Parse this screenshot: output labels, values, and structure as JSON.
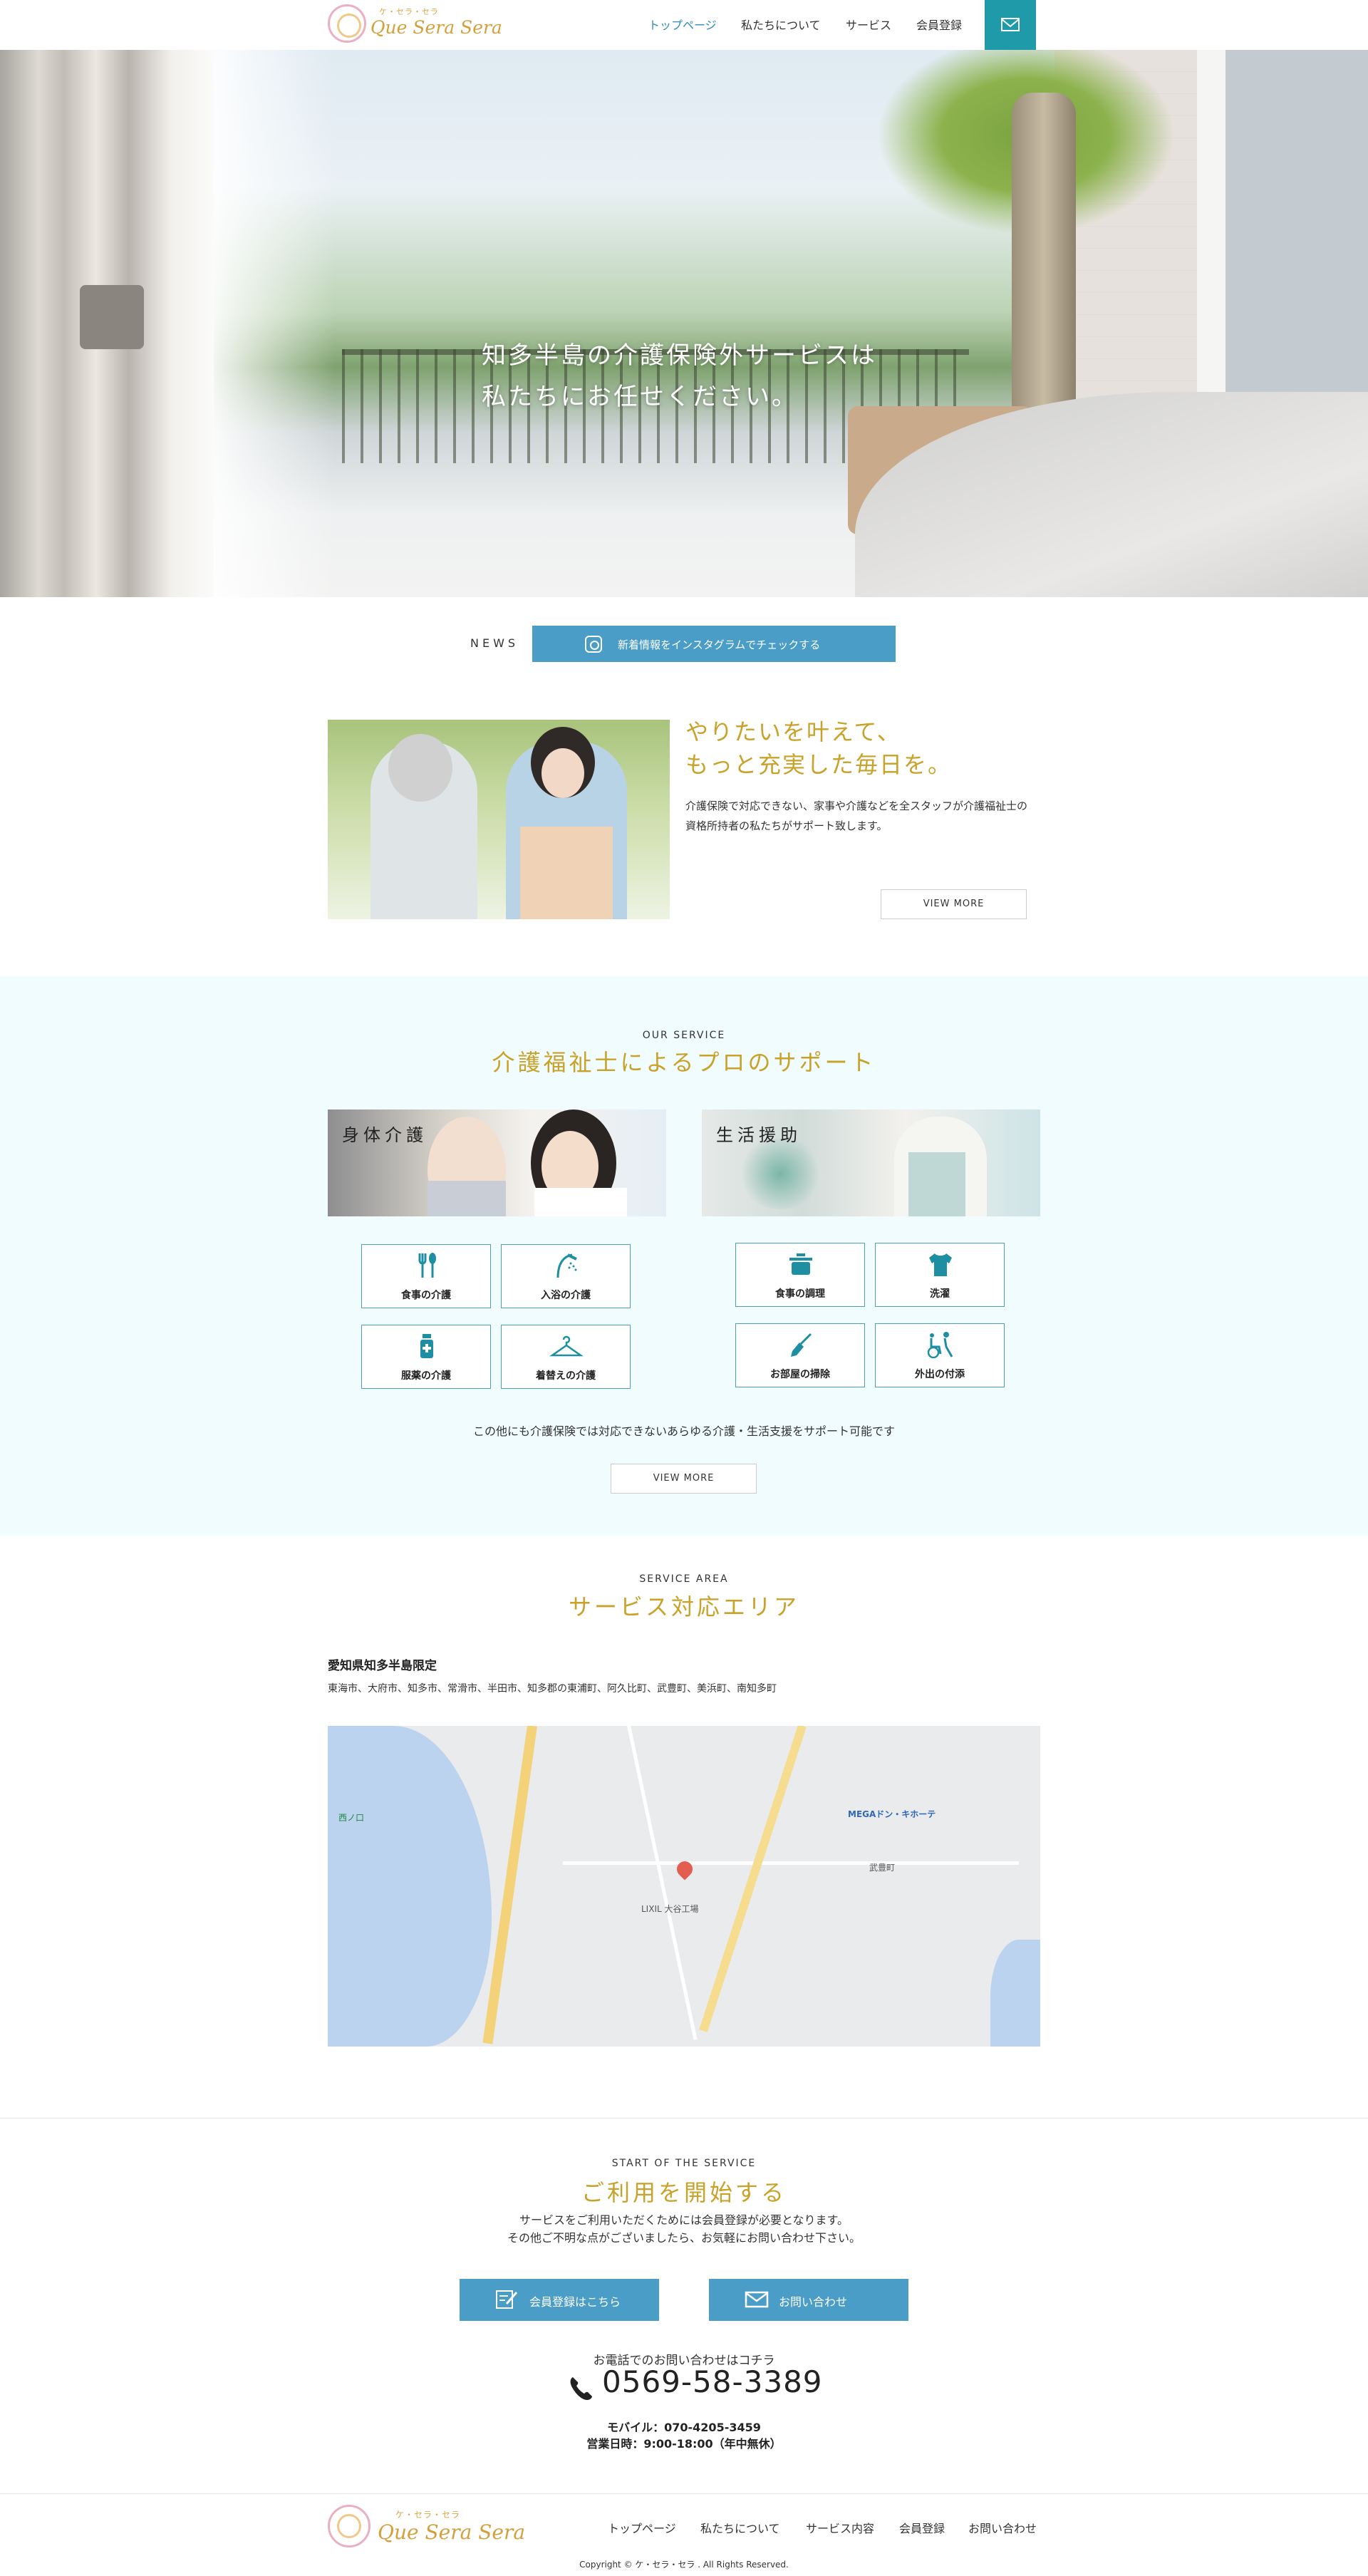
{
  "header": {
    "logo_kana": "ケ・セラ・セラ",
    "logo_text": "Que Sera Sera",
    "nav": {
      "top": "トップページ",
      "about": "私たちについて",
      "service": "サービス",
      "member": "会員登録"
    },
    "mail_icon": "mail-icon",
    "accent_color": "#1e9aa8",
    "active_nav_color": "#2f8cc0"
  },
  "hero": {
    "title_line1": "知多半島の介護保険外サービスは",
    "title_line2": "私たちにお任せください。"
  },
  "news": {
    "label": "NEWS",
    "button_label": "新着情報をインスタグラムでチェックする",
    "button_icon": "instagram-icon",
    "button_color": "#4a9dc6"
  },
  "intro": {
    "title_line1": "やりたいを叶えて、",
    "title_line2": "もっと充実した毎日を。",
    "text": "介護保険で対応できない、家事や介護などを全スタッフが介護福祉士の資格所持者の私たちがサポート致します。",
    "view_more": "VIEW MORE",
    "title_color": "#c9a22a"
  },
  "service": {
    "en": "OUR SERVICE",
    "jp": "介護福祉士によるプロのサポート",
    "physical": {
      "label": "身体介護",
      "items": [
        {
          "label": "食事の介護",
          "icon": "fork-spoon-icon"
        },
        {
          "label": "入浴の介護",
          "icon": "shower-icon"
        },
        {
          "label": "服薬の介護",
          "icon": "medicine-bottle-icon"
        },
        {
          "label": "着替えの介護",
          "icon": "hanger-icon"
        }
      ]
    },
    "life": {
      "label": "生活援助",
      "items": [
        {
          "label": "食事の調理",
          "icon": "pot-icon"
        },
        {
          "label": "洗濯",
          "icon": "shirt-icon"
        },
        {
          "label": "お部屋の掃除",
          "icon": "broom-icon"
        },
        {
          "label": "外出の付添",
          "icon": "wheelchair-icon"
        }
      ]
    },
    "note": "この他にも介護保険では対応できないあらゆる介護・生活支援をサポート可能です",
    "view_more": "VIEW MORE",
    "background_color": "#f0fcfd",
    "icon_color": "#1e8fa3"
  },
  "area": {
    "en": "SERVICE AREA",
    "jp": "サービス対応エリア",
    "prefecture": "愛知県知多半島限定",
    "cities": "東海市、大府市、知多市、常滑市、半田市、知多郡の東浦町、阿久比町、武豊町、美浜町、南知多町",
    "map": {
      "label_mega": "MEGAドン・キホーテ",
      "label_taketoyo": "武豊町",
      "label_lixil": "LIXIL 大谷工場",
      "label_nishinokuchi": "西ノ口"
    }
  },
  "start": {
    "en": "START OF THE SERVICE",
    "jp": "ご利用を開始する",
    "text_line1": "サービスをご利用いただくためには会員登録が必要となります。",
    "text_line2": "その他ご不明な点がございましたら、お気軽にお問い合わせ下さい。",
    "member_button": "会員登録はこちら",
    "contact_button": "お問い合わせ",
    "tel_note": "お電話でのお問い合わせはコチラ",
    "tel_number": "0569-58-3389",
    "mobile": "モバイル：070-4205-3459",
    "hours": "営業日時：9:00-18:00（年中無休）"
  },
  "footer": {
    "logo_kana": "ケ・セラ・セラ",
    "logo_text": "Que Sera Sera",
    "nav": {
      "top": "トップページ",
      "about": "私たちについて",
      "service": "サービス内容",
      "member": "会員登録",
      "contact": "お問い合わせ"
    },
    "copyright": "Copyright © ケ・セラ・セラ . All Rights Reserved."
  }
}
